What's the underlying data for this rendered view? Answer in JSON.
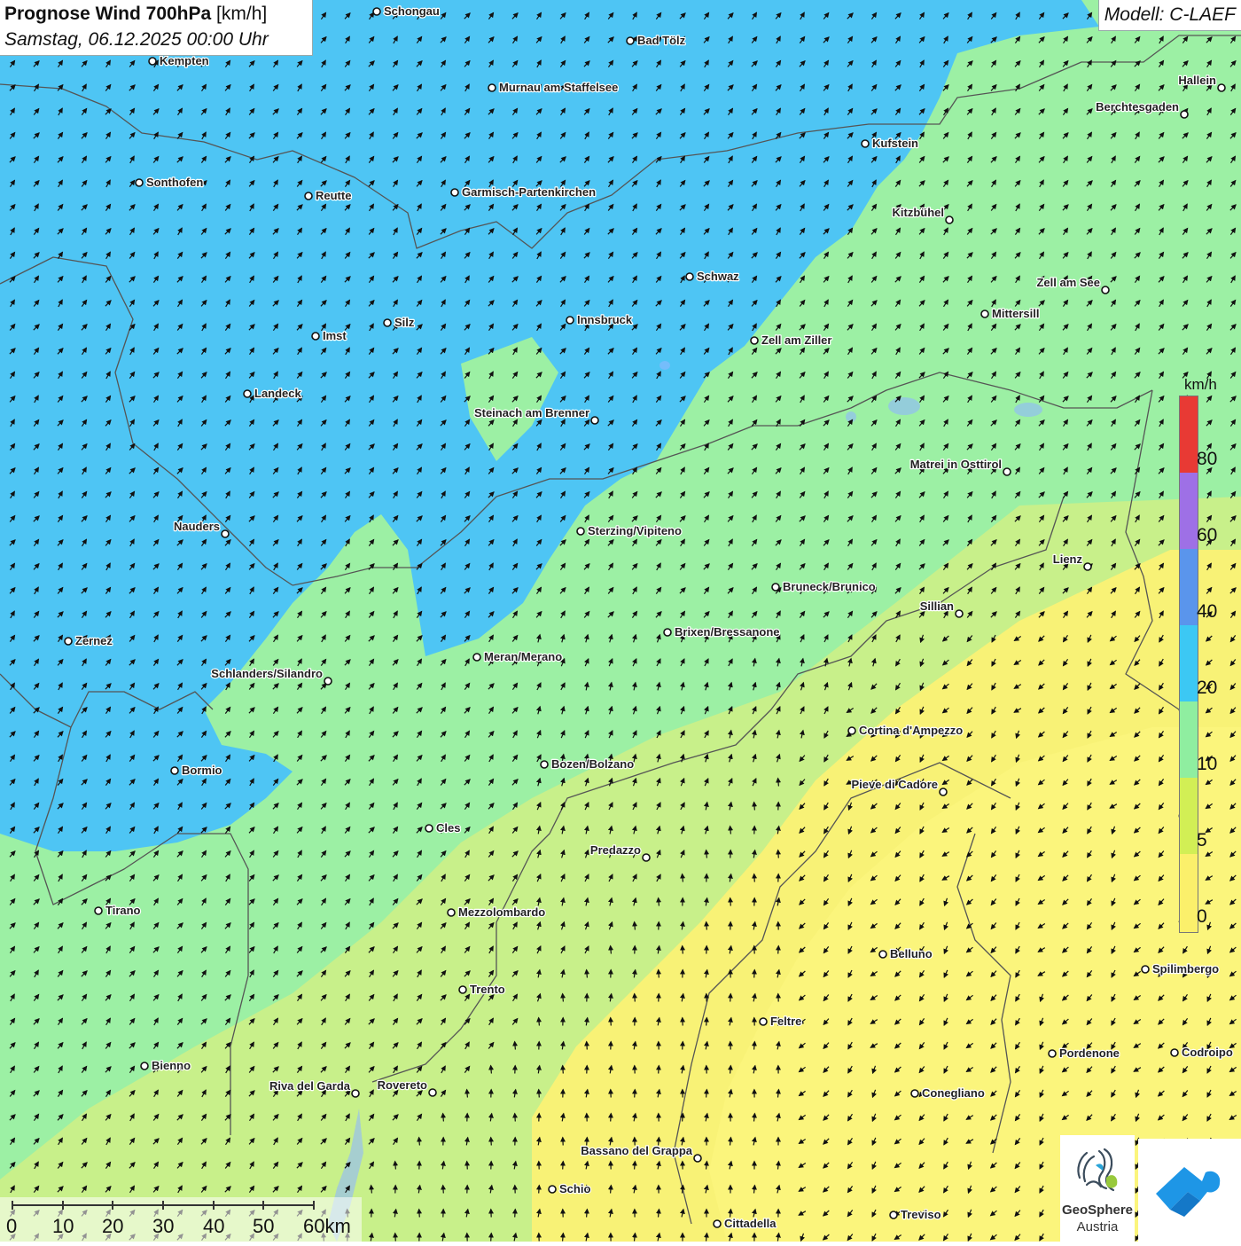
{
  "title": {
    "main": "Prognose Wind 700hPa",
    "unit": "[km/h]",
    "datetime": "Samstag, 06.12.2025 00:00 Uhr"
  },
  "model": "Modell: C-LAEF",
  "legend": {
    "unit": "km/h",
    "ticks": [
      "80",
      "60",
      "40",
      "20",
      "10",
      "5",
      "0"
    ],
    "colors": [
      "#e83a34",
      "#9e70e6",
      "#5a95ec",
      "#3cc8f4",
      "#8feea0",
      "#d2ef55",
      "#fbf06b"
    ]
  },
  "scalebar": {
    "labels": [
      "0",
      "10",
      "20",
      "30",
      "40",
      "50",
      "60km"
    ]
  },
  "logo": {
    "line1": "GeoSphere",
    "line2": "Austria"
  },
  "colors": {
    "blue": "#4ec5f4",
    "green": "#9cf0a4",
    "light_green": "#c2f08c",
    "yellow_green": "#e2f17a",
    "yellow": "#fbf374",
    "arrow": "#111111",
    "border": "#555555"
  },
  "cities": [
    {
      "name": "Schongau"
    },
    {
      "name": "Bad Tölz"
    },
    {
      "name": "Kempten"
    },
    {
      "name": "Murnau am Staffelsee"
    },
    {
      "name": "Hallein"
    },
    {
      "name": "Berchtesgaden"
    },
    {
      "name": "Kufstein"
    },
    {
      "name": "Sonthofen"
    },
    {
      "name": "Reutte"
    },
    {
      "name": "Garmisch-Partenkirchen"
    },
    {
      "name": "Kitzbühel"
    },
    {
      "name": "Schwaz"
    },
    {
      "name": "Zell am See"
    },
    {
      "name": "Mittersill"
    },
    {
      "name": "Innsbruck"
    },
    {
      "name": "Silz"
    },
    {
      "name": "Imst"
    },
    {
      "name": "Zell am Ziller"
    },
    {
      "name": "Landeck"
    },
    {
      "name": "Steinach am Brenner"
    },
    {
      "name": "Matrei in Osttirol"
    },
    {
      "name": "Nauders"
    },
    {
      "name": "Sterzing/Vipiteno"
    },
    {
      "name": "Lienz"
    },
    {
      "name": "Bruneck/Brunico"
    },
    {
      "name": "Sillian"
    },
    {
      "name": "Brixen/Bressanone"
    },
    {
      "name": "Zernez"
    },
    {
      "name": "Meran/Merano"
    },
    {
      "name": "Schlanders/Silandro"
    },
    {
      "name": "Cortina d'Ampezzo"
    },
    {
      "name": "Bozen/Bolzano"
    },
    {
      "name": "Bormio"
    },
    {
      "name": "Pieve di Cadore"
    },
    {
      "name": "Cles"
    },
    {
      "name": "Predazzo"
    },
    {
      "name": "Tirano"
    },
    {
      "name": "Mezzolombardo"
    },
    {
      "name": "Belluno"
    },
    {
      "name": "Spilimbergo"
    },
    {
      "name": "Trento"
    },
    {
      "name": "Feltre"
    },
    {
      "name": "Pordenone"
    },
    {
      "name": "Codroipo"
    },
    {
      "name": "Bienno"
    },
    {
      "name": "Riva del Garda"
    },
    {
      "name": "Rovereto"
    },
    {
      "name": "Conegliano"
    },
    {
      "name": "Bassano del Grappa"
    },
    {
      "name": "Schio"
    },
    {
      "name": "Treviso"
    },
    {
      "name": "Cittadella"
    }
  ]
}
